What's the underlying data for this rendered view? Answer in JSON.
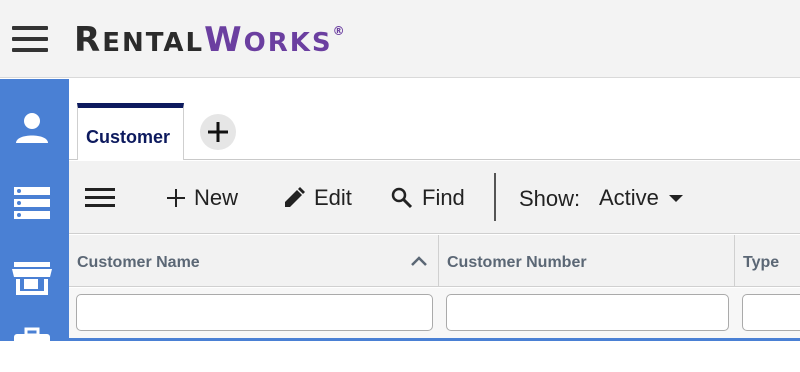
{
  "header": {
    "brand_first_big": "R",
    "brand_first_small": "ENTAL",
    "brand_second_big": "W",
    "brand_second_small": "ORKS",
    "brand_reg": "®",
    "brand_color": "#6b3fa0"
  },
  "leftnav": {
    "color": "#4a80d4",
    "items": [
      {
        "icon": "person-icon"
      },
      {
        "icon": "list-icon"
      },
      {
        "icon": "store-icon"
      },
      {
        "icon": "briefcase-icon"
      }
    ]
  },
  "tabs": {
    "items": [
      {
        "label": "Customer"
      }
    ],
    "add_icon": "plus-icon"
  },
  "toolbar": {
    "menu_icon": "menu-icon",
    "new_label": "New",
    "edit_label": "Edit",
    "find_label": "Find",
    "show_label": "Show:",
    "show_value": "Active"
  },
  "grid": {
    "columns": [
      {
        "label": "Customer Name",
        "sort": "ascending"
      },
      {
        "label": "Customer Number"
      },
      {
        "label": "Type"
      }
    ],
    "filters": [
      {
        "value": "",
        "placeholder": ""
      },
      {
        "value": "",
        "placeholder": ""
      },
      {
        "value": "",
        "placeholder": ""
      }
    ]
  }
}
